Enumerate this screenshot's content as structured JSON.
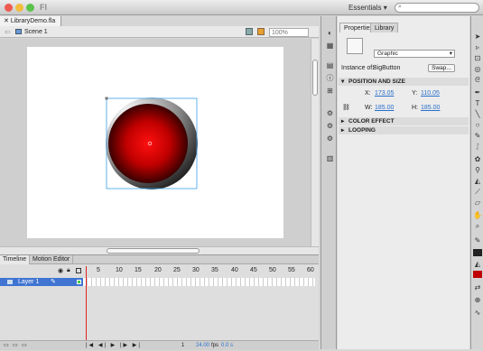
{
  "window": {
    "app_logo": "Fl",
    "workspace": "Essentials",
    "search_placeholder": ""
  },
  "document": {
    "tab_label": "LibraryDemo.fla",
    "scene_label": "Scene 1",
    "zoom": "100%"
  },
  "timeline": {
    "tabs": [
      "Timeline",
      "Motion Editor"
    ],
    "frame_numbers": [
      "5",
      "10",
      "15",
      "20",
      "25",
      "30",
      "35",
      "40",
      "45",
      "50",
      "55",
      "60"
    ],
    "layer_name": "Layer 1",
    "fps": "24.00",
    "fps_unit": "fps",
    "time": "0.0 s",
    "frame": "1"
  },
  "properties": {
    "tabs": [
      "Properties",
      "Library"
    ],
    "symbol_type": "Graphic",
    "instance_of_label": "Instance of:",
    "instance_of_value": "BigButton",
    "swap_label": "Swap...",
    "position_section": "POSITION AND SIZE",
    "x_label": "X:",
    "x_value": "173.05",
    "y_label": "Y:",
    "y_value": "110.05",
    "w_label": "W:",
    "w_value": "185.00",
    "h_label": "H:",
    "h_value": "185.00",
    "color_section": "COLOR EFFECT",
    "looping_section": "LOOPING"
  },
  "colors": {
    "accent": "#3f74d2",
    "playhead": "#d22222",
    "button_red": "#e00000"
  }
}
